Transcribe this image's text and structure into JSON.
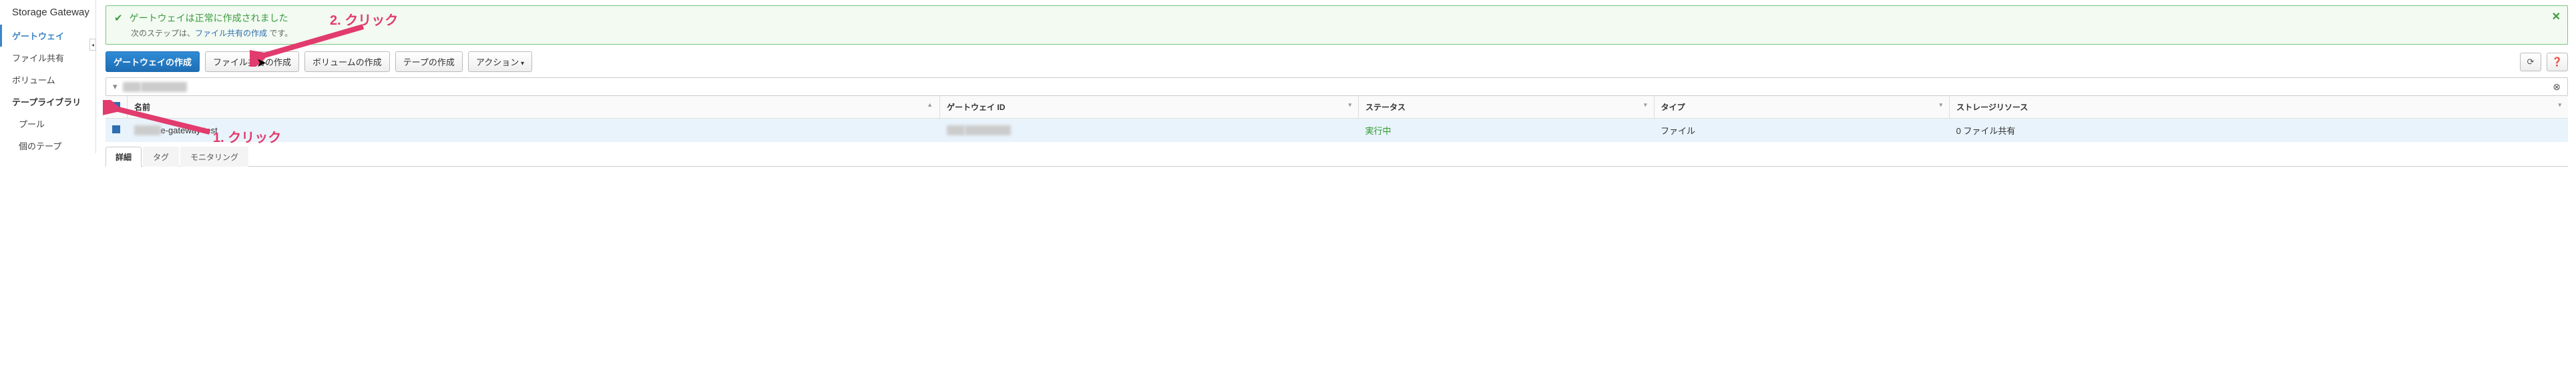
{
  "service_title": "Storage Gateway",
  "sidebar": {
    "items": [
      {
        "label": "ゲートウェイ",
        "kind": "active"
      },
      {
        "label": "ファイル共有",
        "kind": "normal"
      },
      {
        "label": "ボリューム",
        "kind": "normal"
      },
      {
        "label": "テープライブラリ",
        "kind": "heading"
      },
      {
        "label": "プール",
        "kind": "sub"
      },
      {
        "label": "個のテープ",
        "kind": "sub"
      }
    ]
  },
  "alert": {
    "title": "ゲートウェイは正常に作成されました",
    "subtitle_prefix": "次のステップは、",
    "subtitle_link": "ファイル共有の作成",
    "subtitle_suffix": " です。"
  },
  "toolbar": {
    "create_gateway": "ゲートウェイの作成",
    "create_fileshare": "ファイル共有の作成",
    "create_volume": "ボリュームの作成",
    "create_tape": "テープの作成",
    "actions": "アクション"
  },
  "filter": {
    "prefix_visible": "sgw-",
    "hidden": "XXXXXXXX"
  },
  "table": {
    "headers": {
      "name": "名前",
      "gateway_id": "ゲートウェイ ID",
      "status": "ステータス",
      "type": "タイプ",
      "storage": "ストレージリソース"
    },
    "row": {
      "name_visible_suffix": "e-gateway-test",
      "gateway_id_prefix": "sgw-",
      "gateway_id_hidden": "XXXXXXXX",
      "status": "実行中",
      "type": "ファイル",
      "storage": "0 ファイル共有"
    }
  },
  "tabs": {
    "details": "詳細",
    "tags": "タグ",
    "monitoring": "モニタリング"
  },
  "annotations": {
    "click1": "1. クリック",
    "click2": "2. クリック"
  }
}
